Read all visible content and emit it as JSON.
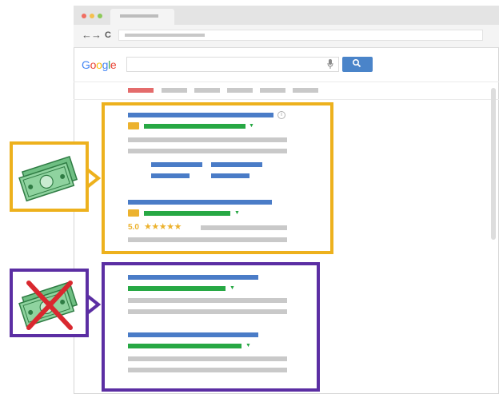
{
  "browser": {
    "window_dots": [
      "#f06d61",
      "#f5c04d",
      "#8dca5a"
    ],
    "nav_glyphs": {
      "back": "←",
      "forward": "→",
      "reload": "C"
    }
  },
  "search": {
    "logo_letters": [
      {
        "char": "G",
        "color": "#4285f4"
      },
      {
        "char": "o",
        "color": "#ea4335"
      },
      {
        "char": "o",
        "color": "#fbbc05"
      },
      {
        "char": "g",
        "color": "#4285f4"
      },
      {
        "char": "l",
        "color": "#34a853"
      },
      {
        "char": "e",
        "color": "#ea4335"
      }
    ],
    "mic_glyph": "🎙",
    "search_glyph": "🔍",
    "active_tab_color": "#e46c6c"
  },
  "results": {
    "paid_ad_1": {
      "info_glyph": "i"
    },
    "paid_ad_2": {
      "rating": "5.0",
      "stars": "★★★★★"
    }
  },
  "legend": {
    "paid_frame_color": "#edb11d",
    "organic_frame_color": "#5b2ea3",
    "paid_icon": "money-icon",
    "organic_icon": "no-money-icon",
    "cross_color": "#d9282f"
  }
}
